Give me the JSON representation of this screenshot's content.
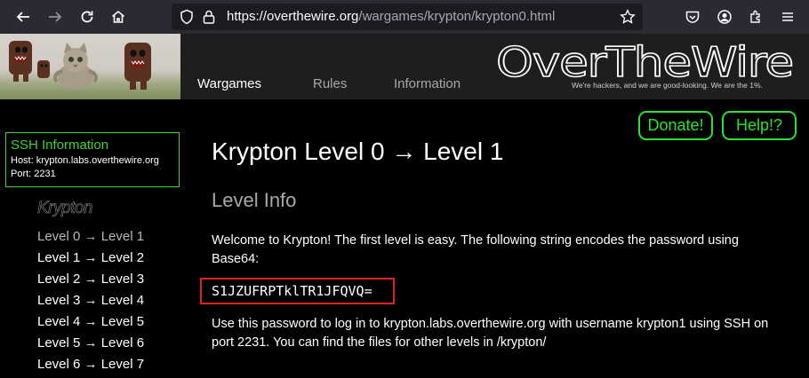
{
  "browser": {
    "url_host": "https://overthewire.org",
    "url_path": "/wargames/krypton/krypton0.html",
    "icons": [
      "back-arrow-icon",
      "forward-arrow-icon",
      "reload-icon",
      "home-icon",
      "shield-icon",
      "lock-icon",
      "star-icon",
      "pocket-icon",
      "account-icon",
      "extensions-icon",
      "menu-icon"
    ]
  },
  "header": {
    "nav": [
      "Wargames",
      "Rules",
      "Information"
    ],
    "logo_text": "OverTheWire",
    "tagline": "We're hackers, and we are good-looking. We are the 1%."
  },
  "sidebar": {
    "ssh_title": "SSH Information",
    "ssh_host": "Host: krypton.labs.overthewire.org",
    "ssh_port": "Port: 2231",
    "heading": "Krypton",
    "levels": [
      "Level 0 → Level 1",
      "Level 1 → Level 2",
      "Level 2 → Level 3",
      "Level 3 → Level 4",
      "Level 4 → Level 5",
      "Level 5 → Level 6",
      "Level 6 → Level 7"
    ]
  },
  "main": {
    "donate_label": "Donate!",
    "help_label": "Help!?",
    "title": "Krypton Level 0 → Level 1",
    "section": "Level Info",
    "para1": "Welcome to Krypton! The first level is easy. The following string encodes the password using Base64:",
    "code": "S1JZUFRPTklTR1JFQVQ=",
    "para2": "Use this password to log in to krypton.labs.overthewire.org with username krypton1 using SSH on port 2231. You can find the files for other levels in /krypton/"
  },
  "colors": {
    "accent_green": "#2ee02e",
    "highlight_red": "#e02020",
    "browser_bg": "#2b2a33"
  }
}
